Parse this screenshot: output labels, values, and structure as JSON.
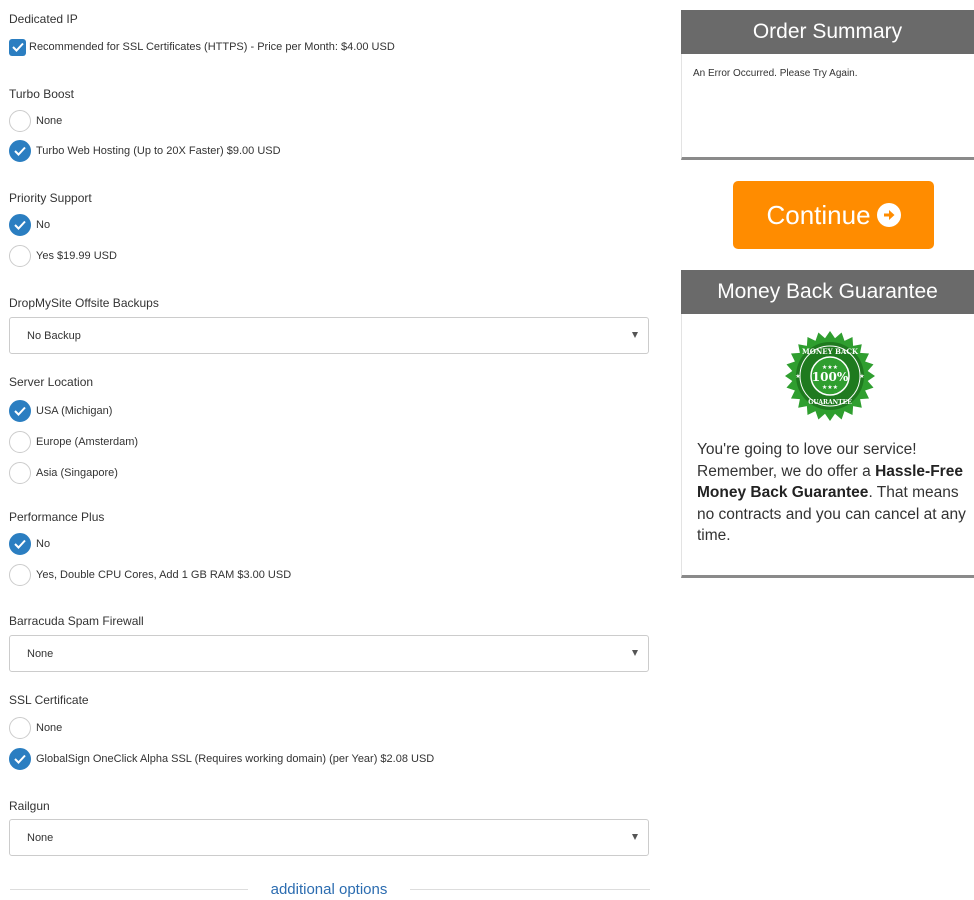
{
  "groups": [
    {
      "label": "Dedicated IP",
      "options": [
        {
          "text": "Recommended for SSL Certificates (HTTPS) - Price per Month: $4.00 USD",
          "checked": true,
          "kind": "checkbox"
        }
      ]
    },
    {
      "label": "Turbo Boost",
      "options": [
        {
          "text": "None",
          "checked": false
        },
        {
          "text": "Turbo Web Hosting (Up to 20X Faster) $9.00 USD",
          "checked": true
        }
      ]
    },
    {
      "label": "Priority Support",
      "options": [
        {
          "text": "No",
          "checked": true
        },
        {
          "text": "Yes $19.99 USD",
          "checked": false
        }
      ]
    },
    {
      "label": "DropMySite Offsite Backups",
      "select": "No Backup"
    },
    {
      "label": "Server Location",
      "options": [
        {
          "text": "USA (Michigan)",
          "checked": true
        },
        {
          "text": "Europe (Amsterdam)",
          "checked": false
        },
        {
          "text": "Asia (Singapore)",
          "checked": false
        }
      ]
    },
    {
      "label": "Performance Plus",
      "options": [
        {
          "text": "No",
          "checked": true
        },
        {
          "text": "Yes, Double CPU Cores, Add 1 GB RAM $3.00 USD",
          "checked": false
        }
      ]
    },
    {
      "label": "Barracuda Spam Firewall",
      "select": "None"
    },
    {
      "label": "SSL Certificate",
      "options": [
        {
          "text": "None",
          "checked": false
        },
        {
          "text": "GlobalSign OneClick Alpha SSL (Requires working domain) (per Year) $2.08 USD",
          "checked": true
        }
      ]
    },
    {
      "label": "Railgun",
      "select": "None"
    }
  ],
  "divider_label": "additional options",
  "summary": {
    "title": "Order Summary",
    "message": "An Error Occurred. Please Try Again."
  },
  "continue_label": "Continue",
  "guarantee": {
    "title": "Money Back Guarantee",
    "seal_top": "MONEY BACK",
    "seal_center": "100%",
    "seal_bottom": "GUARANTEE",
    "text_intro": "You're going to love our service! Remember, we do offer a ",
    "text_bold": "Hassle-Free Money Back Guarantee",
    "text_outro": ". That means no contracts and you can cancel at any time."
  },
  "colors": {
    "accent_blue": "#2b7ec1",
    "continue_orange": "#ff8c00",
    "panel_header": "#6a6a6a",
    "seal_green": "#2f9e2f"
  },
  "icons": {
    "checkbox": "check-icon",
    "continue": "arrow-circle-right-icon",
    "seal": "money-back-seal-icon",
    "select": "caret-down-icon"
  }
}
